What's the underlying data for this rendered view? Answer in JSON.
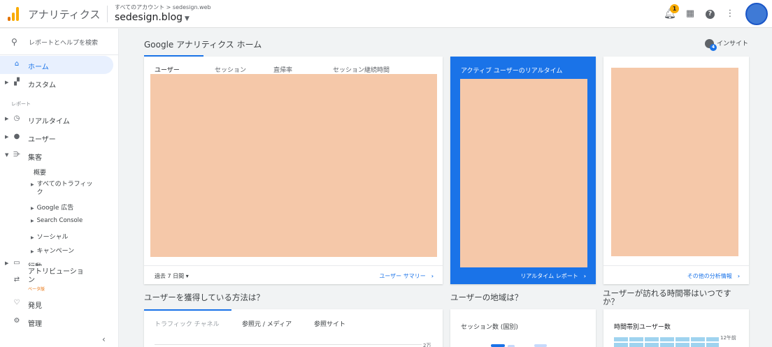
{
  "header": {
    "app_title": "アナリティクス",
    "breadcrumb": "すべてのアカウント > sedesign.web",
    "property": "sedesign.blog",
    "notification_count": "1"
  },
  "sidebar": {
    "search_placeholder": "レポートとヘルプを検索",
    "home": "ホーム",
    "custom": "カスタム",
    "reports_section": "レポート",
    "realtime": "リアルタイム",
    "audience": "ユーザー",
    "acquisition": "集客",
    "acquisition_sub": [
      "概要",
      "すべてのトラフィック",
      "Google 広告",
      "Search Console",
      "ソーシャル",
      "キャンペーン"
    ],
    "behavior": "行動",
    "attribution": "アトリビューション",
    "beta": "ベータ版",
    "discover": "発見",
    "admin": "管理"
  },
  "main": {
    "page_title": "Google アナリティクス ホーム",
    "insight": "インサイト",
    "insight_badge": "4",
    "card1": {
      "tabs": [
        "ユーザー",
        "セッション",
        "直帰率",
        "セッション継続時間"
      ],
      "period": "過去 7 日間",
      "footer_link": "ユーザー サマリー"
    },
    "card2": {
      "title": "アクティブ ユーザーのリアルタイム",
      "footer_link": "リアルタイム レポート"
    },
    "card3": {
      "footer_link": "その他の分析情報"
    },
    "q1": "ユーザーを獲得している方法は？",
    "q2": "ユーザーの地域は？",
    "q3": "ユーザーが訪れる時間帯はいつですか？",
    "card4": {
      "tabs": [
        "トラフィック チャネル",
        "参照元 / メディア",
        "参照サイト"
      ],
      "tick": "2万"
    },
    "card5": {
      "title": "セッション数 (国別)"
    },
    "card6": {
      "title": "時間帯別ユーザー数",
      "hour_label": "12午前"
    }
  },
  "colors": {
    "accent": "#1a73e8",
    "placeholder": "#f5c8a9",
    "logo_orange": "#f9ab00",
    "logo_dark": "#e37400"
  }
}
